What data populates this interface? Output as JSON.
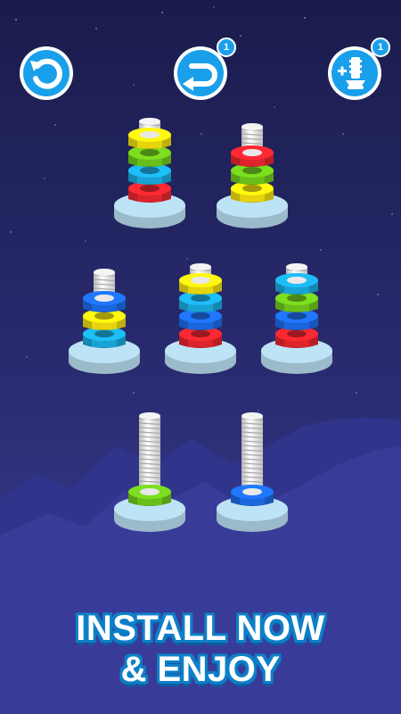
{
  "colors": {
    "bg_top": "#1a1c4c",
    "bg_bottom": "#3d3f9a",
    "mountain": "#343892",
    "base": "#bde3f6",
    "accent": "#1aa0ea",
    "red": "#e0242c",
    "green": "#6cc21c",
    "blue": "#1c68e0",
    "cyan": "#1aa6d8",
    "yellow": "#e9d80e",
    "screw": "#e4e4e4"
  },
  "toolbar": {
    "undo": {
      "icon": "undo-icon"
    },
    "redo": {
      "icon": "redo-icon",
      "badge": "1"
    },
    "add_screw": {
      "icon": "add-screw-icon",
      "badge": "1"
    }
  },
  "screws": [
    {
      "nuts": [
        "red",
        "cyan",
        "green",
        "yellow"
      ]
    },
    {
      "nuts": [
        "yellow",
        "green",
        "red"
      ]
    },
    {
      "nuts": [
        "cyan",
        "yellow",
        "blue"
      ]
    },
    {
      "nuts": [
        "red",
        "blue",
        "cyan",
        "yellow"
      ]
    },
    {
      "nuts": [
        "red",
        "blue",
        "green",
        "cyan"
      ]
    },
    {
      "nuts": [
        "green"
      ]
    },
    {
      "nuts": [
        "blue"
      ]
    }
  ],
  "cta": {
    "line1": "INSTALL NOW",
    "line2": "& ENJOY"
  }
}
